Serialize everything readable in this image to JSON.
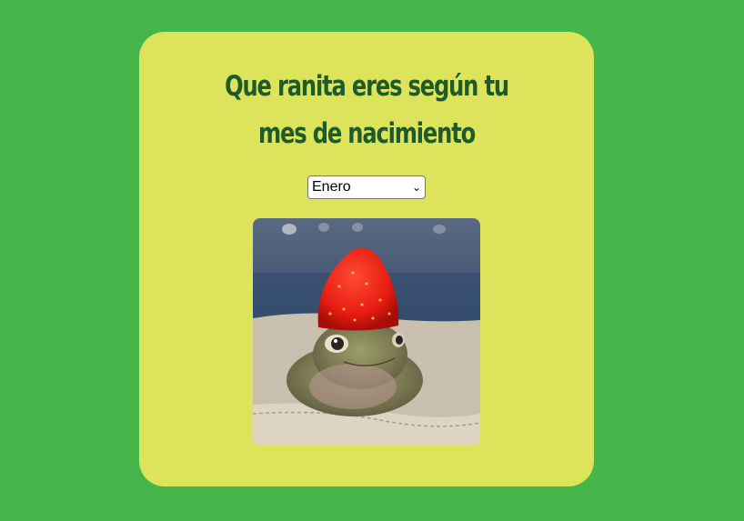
{
  "card": {
    "title": "Que ranita eres según tu mes de nacimiento"
  },
  "month_select": {
    "selected": "Enero"
  },
  "image": {
    "subject": "frog-with-strawberry-hat"
  },
  "colors": {
    "background": "#46b64a",
    "card": "#dee35c",
    "title": "#1f5a2b"
  }
}
